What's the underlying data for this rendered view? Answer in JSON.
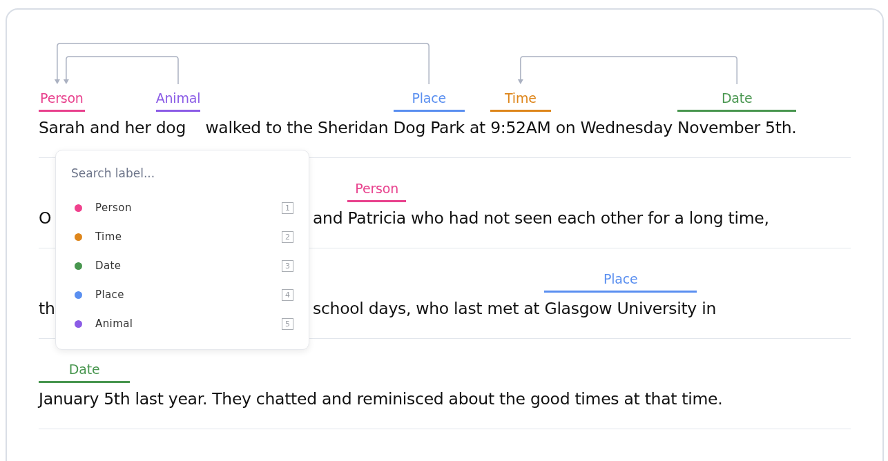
{
  "lines": [
    {
      "segments": [
        {
          "text": "Sarah",
          "label": "Person",
          "color": "#e8418d"
        },
        {
          "text": " and her "
        },
        {
          "text": "dog",
          "label": "Animal",
          "color": "#8b5ce6"
        },
        {
          "text": " walked to the Sheridan "
        },
        {
          "text": "Dog Park",
          "label": "Place",
          "color": "#5a8ff0"
        },
        {
          "text": " at "
        },
        {
          "text": "9:52AM",
          "label": "Time",
          "color": "#de861b"
        },
        {
          "text": " on Wednesday "
        },
        {
          "text": "November 5th.",
          "label": "Date",
          "color": "#48964f"
        }
      ]
    },
    {
      "segments": [
        {
          "text": "O"
        },
        {
          "kind": "covered"
        },
        {
          "text": "and "
        },
        {
          "text": "Patricia",
          "label": "Person",
          "color": "#e8418d"
        },
        {
          "text": " who had not seen each other for a long time,"
        }
      ]
    },
    {
      "segments": [
        {
          "text": "th"
        },
        {
          "kind": "covered"
        },
        {
          "text": "school days, who last met at "
        },
        {
          "text": "Glasgow University",
          "label": "Place",
          "color": "#5a8ff0"
        },
        {
          "text": " in"
        }
      ]
    },
    {
      "segments": [
        {
          "text": "January 5th",
          "label": "Date",
          "color": "#48964f"
        },
        {
          "text": " last year. They chatted and reminisced about the good times at that time."
        }
      ]
    }
  ],
  "label_menu": {
    "search": {
      "placeholder": "Search label..."
    },
    "items": [
      {
        "label": "Person",
        "color": "#f0418d",
        "key": "1",
        "selected": false
      },
      {
        "label": "Time",
        "color": "#de861b",
        "key": "2",
        "selected": false
      },
      {
        "label": "Date",
        "color": "#48964f",
        "key": "3",
        "selected": false
      },
      {
        "label": "Place",
        "color": "#5a8ff0",
        "key": "4",
        "selected": false
      },
      {
        "label": "Animal",
        "color": "#8b5ce6",
        "key": "5",
        "selected": false
      }
    ]
  }
}
